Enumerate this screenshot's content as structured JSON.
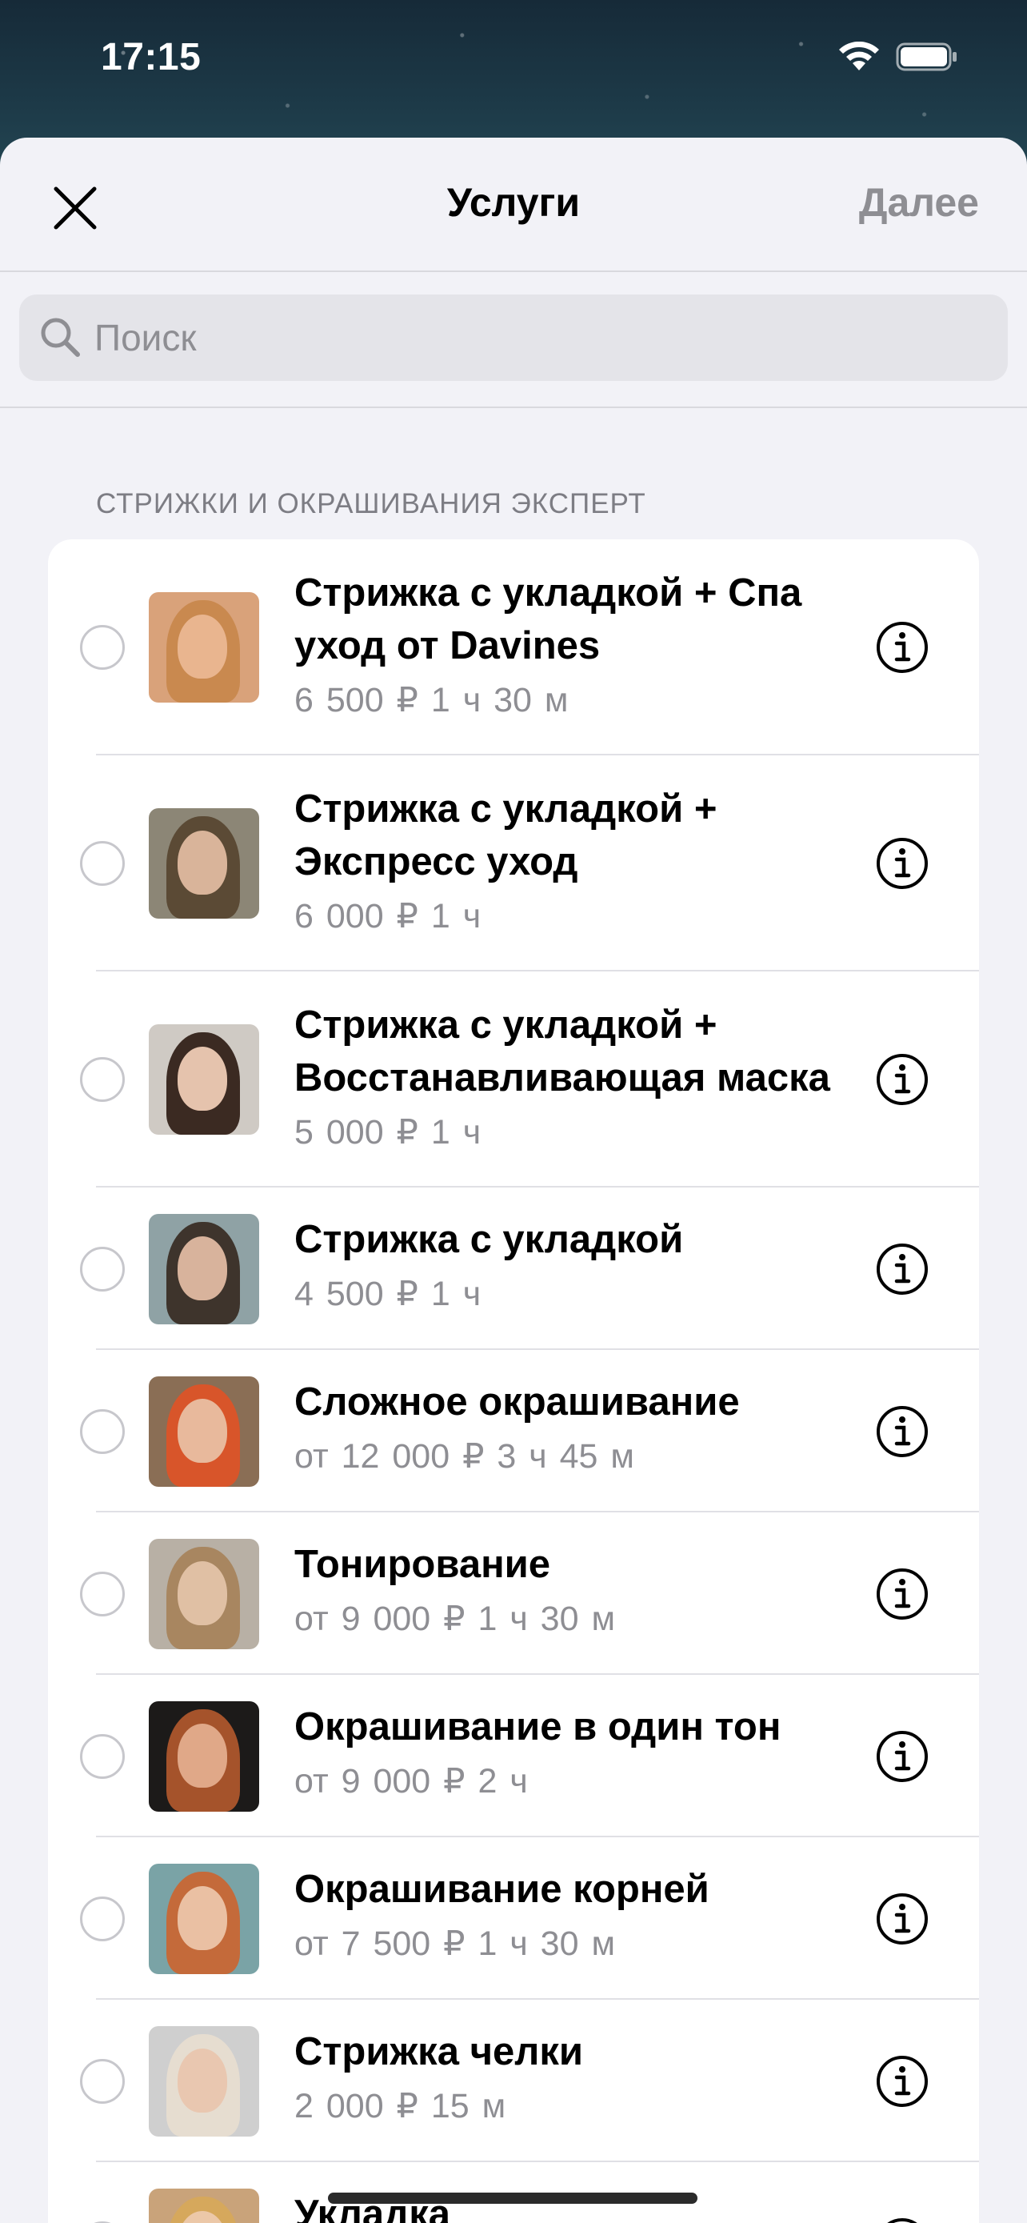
{
  "status": {
    "time": "17:15"
  },
  "nav": {
    "title": "Услуги",
    "next": "Далее"
  },
  "search": {
    "placeholder": "Поиск"
  },
  "section": {
    "header": "СТРИЖКИ И ОКРАШИВАНИЯ ЭКСПЕРТ"
  },
  "services": [
    {
      "title": "Стрижка с укладкой + Спа уход от Davines",
      "price": "6 500 ₽  1 ч 30 м",
      "photo": {
        "bg": "#d9a27a",
        "hair": "#c9894f",
        "face": "#e9b58f"
      }
    },
    {
      "title": "Стрижка с укладкой + Экспресс уход",
      "price": "6 000 ₽  1 ч",
      "photo": {
        "bg": "#8c8676",
        "hair": "#5b4a35",
        "face": "#d9b49a"
      }
    },
    {
      "title": "Стрижка с укладкой + Восстанавливающая маска",
      "price": "5 000 ₽  1 ч",
      "photo": {
        "bg": "#cfcac4",
        "hair": "#3b2a22",
        "face": "#e5c3ad"
      }
    },
    {
      "title": "Стрижка с укладкой",
      "price": "4 500 ₽  1 ч",
      "photo": {
        "bg": "#8fa2a5",
        "hair": "#3e342c",
        "face": "#d8b39c"
      }
    },
    {
      "title": "Сложное окрашивание",
      "price": "от 12 000 ₽  3 ч 45 м",
      "photo": {
        "bg": "#8a6e55",
        "hair": "#d8552a",
        "face": "#e8b99c"
      }
    },
    {
      "title": "Тонирование",
      "price": "от 9 000 ₽  1 ч 30 м",
      "photo": {
        "bg": "#b8b0a5",
        "hair": "#a88660",
        "face": "#e0c0a4"
      }
    },
    {
      "title": "Окрашивание в один тон",
      "price": "от 9 000 ₽  2 ч",
      "photo": {
        "bg": "#1c1a19",
        "hair": "#a5532b",
        "face": "#e0a888"
      }
    },
    {
      "title": "Окрашивание корней",
      "price": "от 7 500 ₽  1 ч 30 м",
      "photo": {
        "bg": "#7aa3a6",
        "hair": "#c46a3a",
        "face": "#eac0a3"
      }
    },
    {
      "title": "Стрижка челки",
      "price": "2 000 ₽  15 м",
      "photo": {
        "bg": "#cfcfcf",
        "hair": "#e6ddd0",
        "face": "#e9c7b0"
      }
    },
    {
      "title": "Укладка",
      "price": "",
      "photo": {
        "bg": "#c9a37a",
        "hair": "#d6a85c",
        "face": "#ecc8a8"
      }
    }
  ]
}
